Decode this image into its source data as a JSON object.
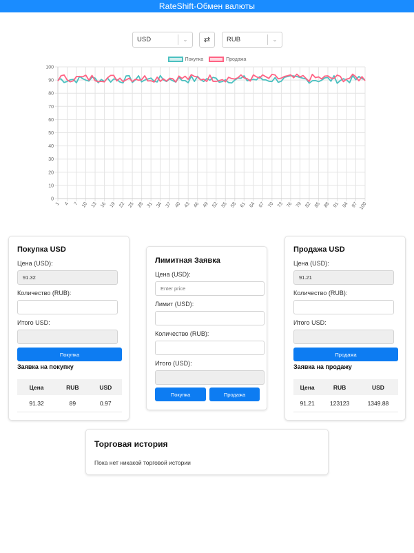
{
  "app": {
    "title": "RateShift-Обмен валюты"
  },
  "pair": {
    "base": "USD",
    "quote": "RUB"
  },
  "chart_data": {
    "type": "line",
    "ylim": [
      0,
      100
    ],
    "y_ticks": [
      0,
      10,
      20,
      30,
      40,
      50,
      60,
      70,
      80,
      90,
      100
    ],
    "x_tick_labels": [
      "1",
      "4",
      "7",
      "10",
      "13",
      "16",
      "19",
      "22",
      "25",
      "28",
      "31",
      "34",
      "37",
      "40",
      "43",
      "46",
      "49",
      "52",
      "55",
      "58",
      "61",
      "64",
      "67",
      "70",
      "73",
      "76",
      "79",
      "82",
      "85",
      "88",
      "91",
      "94",
      "97",
      "100"
    ],
    "grid": true,
    "legend_position": "top",
    "series": [
      {
        "name": "Покупка",
        "color": "#4bc0c0"
      },
      {
        "name": "Продажа",
        "color": "#ff6384"
      }
    ]
  },
  "buy": {
    "title": "Покупка USD",
    "price_label": "Цена (USD):",
    "price_value": "91.32",
    "qty_label": "Количество (RUB):",
    "qty_value": "",
    "total_label": "Итого USD:",
    "total_value": "",
    "button": "Покупка",
    "orders_title": "Заявка на покупку",
    "headers": [
      "Цена",
      "RUB",
      "USD"
    ],
    "rows": [
      [
        "91.32",
        "89",
        "0.97"
      ]
    ]
  },
  "limit": {
    "title": "Лимитная Заявка",
    "price_label": "Цена (USD):",
    "price_placeholder": "Enter price",
    "limit_label": "Лимит (USD):",
    "qty_label": "Количество (RUB):",
    "total_label": "Итого (USD):",
    "buy_button": "Покупка",
    "sell_button": "Продажа"
  },
  "sell": {
    "title": "Продажа USD",
    "price_label": "Цена (USD):",
    "price_value": "91.21",
    "qty_label": "Количество (RUB):",
    "qty_value": "",
    "total_label": "Итого USD:",
    "total_value": "",
    "button": "Продажа",
    "orders_title": "Заявка на продажу",
    "headers": [
      "Цена",
      "RUB",
      "USD"
    ],
    "rows": [
      [
        "91.21",
        "123123",
        "1349.88"
      ]
    ]
  },
  "history": {
    "title": "Торговая история",
    "empty_text": "Пока нет никакой торговой истории"
  }
}
